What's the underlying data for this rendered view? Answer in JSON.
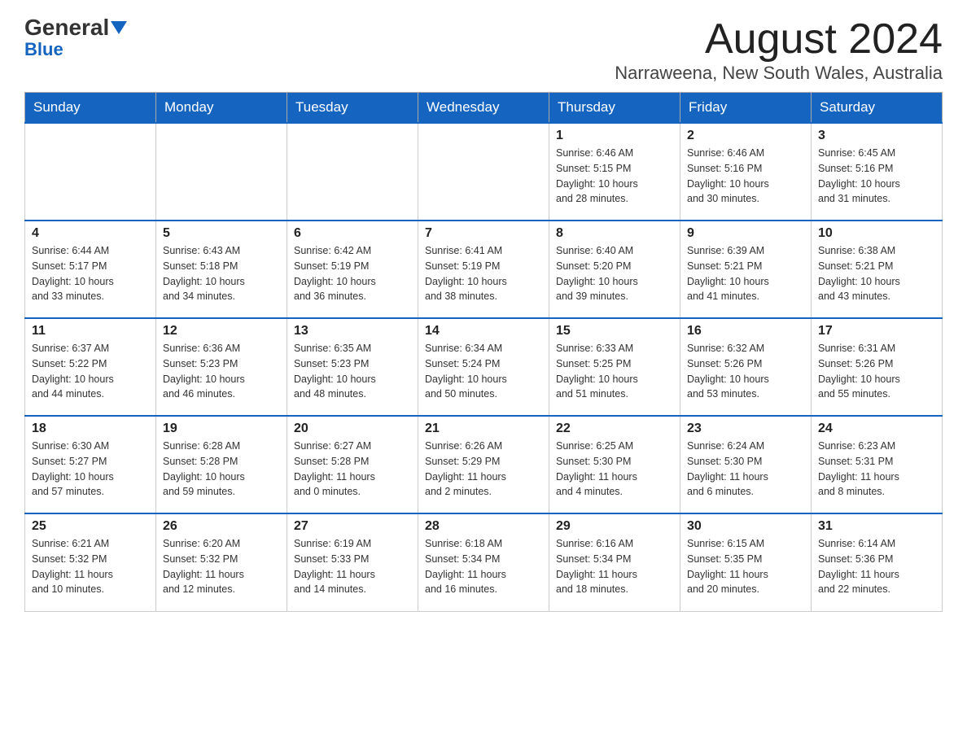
{
  "header": {
    "logo_text_black": "General",
    "logo_text_blue": "Blue",
    "month_title": "August 2024",
    "location": "Narraweena, New South Wales, Australia"
  },
  "weekdays": [
    "Sunday",
    "Monday",
    "Tuesday",
    "Wednesday",
    "Thursday",
    "Friday",
    "Saturday"
  ],
  "weeks": [
    [
      {
        "day": "",
        "info": ""
      },
      {
        "day": "",
        "info": ""
      },
      {
        "day": "",
        "info": ""
      },
      {
        "day": "",
        "info": ""
      },
      {
        "day": "1",
        "info": "Sunrise: 6:46 AM\nSunset: 5:15 PM\nDaylight: 10 hours\nand 28 minutes."
      },
      {
        "day": "2",
        "info": "Sunrise: 6:46 AM\nSunset: 5:16 PM\nDaylight: 10 hours\nand 30 minutes."
      },
      {
        "day": "3",
        "info": "Sunrise: 6:45 AM\nSunset: 5:16 PM\nDaylight: 10 hours\nand 31 minutes."
      }
    ],
    [
      {
        "day": "4",
        "info": "Sunrise: 6:44 AM\nSunset: 5:17 PM\nDaylight: 10 hours\nand 33 minutes."
      },
      {
        "day": "5",
        "info": "Sunrise: 6:43 AM\nSunset: 5:18 PM\nDaylight: 10 hours\nand 34 minutes."
      },
      {
        "day": "6",
        "info": "Sunrise: 6:42 AM\nSunset: 5:19 PM\nDaylight: 10 hours\nand 36 minutes."
      },
      {
        "day": "7",
        "info": "Sunrise: 6:41 AM\nSunset: 5:19 PM\nDaylight: 10 hours\nand 38 minutes."
      },
      {
        "day": "8",
        "info": "Sunrise: 6:40 AM\nSunset: 5:20 PM\nDaylight: 10 hours\nand 39 minutes."
      },
      {
        "day": "9",
        "info": "Sunrise: 6:39 AM\nSunset: 5:21 PM\nDaylight: 10 hours\nand 41 minutes."
      },
      {
        "day": "10",
        "info": "Sunrise: 6:38 AM\nSunset: 5:21 PM\nDaylight: 10 hours\nand 43 minutes."
      }
    ],
    [
      {
        "day": "11",
        "info": "Sunrise: 6:37 AM\nSunset: 5:22 PM\nDaylight: 10 hours\nand 44 minutes."
      },
      {
        "day": "12",
        "info": "Sunrise: 6:36 AM\nSunset: 5:23 PM\nDaylight: 10 hours\nand 46 minutes."
      },
      {
        "day": "13",
        "info": "Sunrise: 6:35 AM\nSunset: 5:23 PM\nDaylight: 10 hours\nand 48 minutes."
      },
      {
        "day": "14",
        "info": "Sunrise: 6:34 AM\nSunset: 5:24 PM\nDaylight: 10 hours\nand 50 minutes."
      },
      {
        "day": "15",
        "info": "Sunrise: 6:33 AM\nSunset: 5:25 PM\nDaylight: 10 hours\nand 51 minutes."
      },
      {
        "day": "16",
        "info": "Sunrise: 6:32 AM\nSunset: 5:26 PM\nDaylight: 10 hours\nand 53 minutes."
      },
      {
        "day": "17",
        "info": "Sunrise: 6:31 AM\nSunset: 5:26 PM\nDaylight: 10 hours\nand 55 minutes."
      }
    ],
    [
      {
        "day": "18",
        "info": "Sunrise: 6:30 AM\nSunset: 5:27 PM\nDaylight: 10 hours\nand 57 minutes."
      },
      {
        "day": "19",
        "info": "Sunrise: 6:28 AM\nSunset: 5:28 PM\nDaylight: 10 hours\nand 59 minutes."
      },
      {
        "day": "20",
        "info": "Sunrise: 6:27 AM\nSunset: 5:28 PM\nDaylight: 11 hours\nand 0 minutes."
      },
      {
        "day": "21",
        "info": "Sunrise: 6:26 AM\nSunset: 5:29 PM\nDaylight: 11 hours\nand 2 minutes."
      },
      {
        "day": "22",
        "info": "Sunrise: 6:25 AM\nSunset: 5:30 PM\nDaylight: 11 hours\nand 4 minutes."
      },
      {
        "day": "23",
        "info": "Sunrise: 6:24 AM\nSunset: 5:30 PM\nDaylight: 11 hours\nand 6 minutes."
      },
      {
        "day": "24",
        "info": "Sunrise: 6:23 AM\nSunset: 5:31 PM\nDaylight: 11 hours\nand 8 minutes."
      }
    ],
    [
      {
        "day": "25",
        "info": "Sunrise: 6:21 AM\nSunset: 5:32 PM\nDaylight: 11 hours\nand 10 minutes."
      },
      {
        "day": "26",
        "info": "Sunrise: 6:20 AM\nSunset: 5:32 PM\nDaylight: 11 hours\nand 12 minutes."
      },
      {
        "day": "27",
        "info": "Sunrise: 6:19 AM\nSunset: 5:33 PM\nDaylight: 11 hours\nand 14 minutes."
      },
      {
        "day": "28",
        "info": "Sunrise: 6:18 AM\nSunset: 5:34 PM\nDaylight: 11 hours\nand 16 minutes."
      },
      {
        "day": "29",
        "info": "Sunrise: 6:16 AM\nSunset: 5:34 PM\nDaylight: 11 hours\nand 18 minutes."
      },
      {
        "day": "30",
        "info": "Sunrise: 6:15 AM\nSunset: 5:35 PM\nDaylight: 11 hours\nand 20 minutes."
      },
      {
        "day": "31",
        "info": "Sunrise: 6:14 AM\nSunset: 5:36 PM\nDaylight: 11 hours\nand 22 minutes."
      }
    ]
  ]
}
